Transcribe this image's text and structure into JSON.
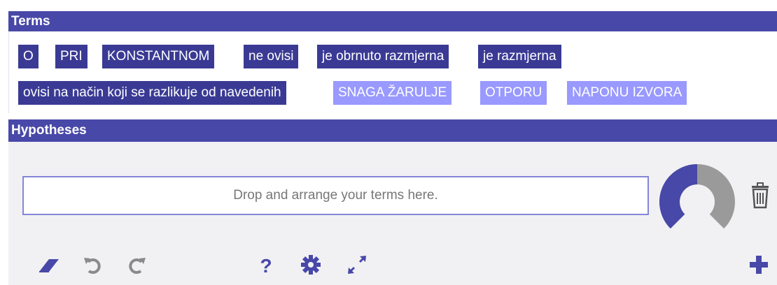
{
  "terms": {
    "title": "Terms",
    "chips": [
      "O",
      "PRI",
      "KONSTANTNOM",
      "ne ovisi",
      "je obrnuto razmjerna",
      "je razmjerna",
      "ovisi na način koji se razlikuje od navedenih",
      "SNAGA ŽARULJE",
      "OTPORU",
      "NAPONU IZVORA"
    ]
  },
  "hypotheses": {
    "title": "Hypotheses",
    "dropzone_placeholder": "Drop and arrange your terms here."
  },
  "gauge": {
    "filled_fraction": 0.5,
    "filled_color": "#4848a8",
    "empty_color": "#9a9a9a"
  },
  "colors": {
    "header": "#4848a8",
    "chip_dark": "#3a3a95",
    "chip_light": "#9999ff",
    "icon": "#4848a8",
    "icon_disabled": "#8a8a8a"
  },
  "toolbar": {
    "icons": [
      "eraser-icon",
      "undo-icon",
      "redo-icon",
      "help-icon",
      "settings-icon",
      "fullscreen-icon",
      "add-icon"
    ]
  }
}
